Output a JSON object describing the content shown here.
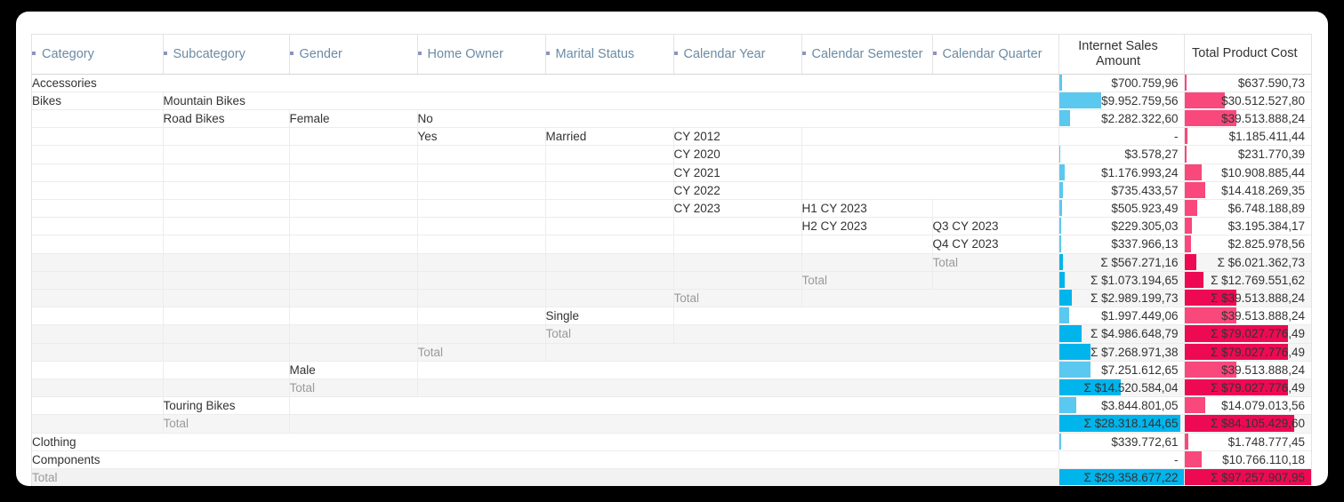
{
  "header": {
    "dimension_columns": [
      {
        "label": "Category",
        "marker": "square-bullet-icon"
      },
      {
        "label": "Subcategory",
        "marker": "square-bullet-icon"
      },
      {
        "label": "Gender",
        "marker": "square-bullet-icon"
      },
      {
        "label": "Home Owner",
        "marker": "square-bullet-icon"
      },
      {
        "label": "Marital Status",
        "marker": "square-bullet-icon"
      },
      {
        "label": "Calendar Year",
        "marker": "square-bullet-icon"
      },
      {
        "label": "Calendar Semester",
        "marker": "square-bullet-icon"
      },
      {
        "label": "Calendar Quarter",
        "marker": "square-bullet-icon"
      }
    ],
    "measure_columns": [
      {
        "label": "Internet Sales Amount",
        "bar_color": "#5BC8EF",
        "total_bar_color": "#00B4EC"
      },
      {
        "label": "Total Product Cost",
        "bar_color": "#F9487B",
        "total_bar_color": "#ED0A53"
      }
    ]
  },
  "colors": {
    "accent_blue": "#00B4EC",
    "light_blue": "#5BC8EF",
    "accent_pink": "#ED0A53",
    "light_pink": "#F9487B",
    "header_text": "#6B8BA4",
    "total_text": "#9A9A9A",
    "total_bg": "#F5F5F5"
  },
  "labels": {
    "total": "Total",
    "sigma": "Σ",
    "dash": "-"
  },
  "rows": [
    {
      "cells": [
        "Accessories",
        "",
        "",
        "",
        "",
        "",
        "",
        ""
      ],
      "sales": "$700.759,96",
      "cost": "$637.590,73",
      "sales_bar": 2.8,
      "cost_bar": 1.4,
      "is_total": false,
      "span": [
        8,
        0,
        0,
        0,
        0,
        0,
        0,
        0
      ]
    },
    {
      "cells": [
        "Bikes",
        "Mountain Bikes",
        "",
        "",
        "",
        "",
        "",
        ""
      ],
      "sales": "$9.952.759,56",
      "cost": "$30.512.527,80",
      "sales_bar": 34.0,
      "cost_bar": 31.6,
      "is_total": false,
      "span": [
        1,
        7,
        0,
        0,
        0,
        0,
        0,
        0
      ]
    },
    {
      "cells": [
        "",
        "Road Bikes",
        "Female",
        "No",
        "",
        "",
        "",
        ""
      ],
      "sales": "$2.282.322,60",
      "cost": "$39.513.888,24",
      "sales_bar": 9.0,
      "cost_bar": 40.9,
      "is_total": false,
      "span": [
        0,
        1,
        1,
        5,
        0,
        0,
        0,
        0
      ]
    },
    {
      "cells": [
        "",
        "",
        "",
        "Yes",
        "Married",
        "CY 2012",
        "",
        ""
      ],
      "sales": "-",
      "cost": "$1.185.411,44",
      "sales_bar": 0,
      "cost_bar": 1.6,
      "is_total": false,
      "span": [
        0,
        0,
        0,
        1,
        1,
        1,
        2,
        0
      ]
    },
    {
      "cells": [
        "",
        "",
        "",
        "",
        "",
        "CY 2020",
        "",
        ""
      ],
      "sales": "$3.578,27",
      "cost": "$231.770,39",
      "sales_bar": 0.6,
      "cost_bar": 0.6,
      "is_total": false,
      "span": [
        0,
        0,
        0,
        0,
        0,
        1,
        2,
        0
      ]
    },
    {
      "cells": [
        "",
        "",
        "",
        "",
        "",
        "CY 2021",
        "",
        ""
      ],
      "sales": "$1.176.993,24",
      "cost": "$10.908.885,44",
      "sales_bar": 4.5,
      "cost_bar": 13.0,
      "is_total": false,
      "span": [
        0,
        0,
        0,
        0,
        0,
        1,
        2,
        0
      ]
    },
    {
      "cells": [
        "",
        "",
        "",
        "",
        "",
        "CY 2022",
        "",
        ""
      ],
      "sales": "$735.433,57",
      "cost": "$14.418.269,35",
      "sales_bar": 3.2,
      "cost_bar": 16.2,
      "is_total": false,
      "span": [
        0,
        0,
        0,
        0,
        0,
        1,
        2,
        0
      ]
    },
    {
      "cells": [
        "",
        "",
        "",
        "",
        "",
        "CY 2023",
        "H1 CY 2023",
        ""
      ],
      "sales": "$505.923,49",
      "cost": "$6.748.188,89",
      "sales_bar": 2.8,
      "cost_bar": 9.6,
      "is_total": false,
      "span": [
        0,
        0,
        0,
        0,
        0,
        1,
        1,
        1
      ]
    },
    {
      "cells": [
        "",
        "",
        "",
        "",
        "",
        "",
        "H2 CY 2023",
        "Q3 CY 2023"
      ],
      "sales": "$229.305,03",
      "cost": "$3.195.384,17",
      "sales_bar": 2.1,
      "cost_bar": 5.0,
      "is_total": false,
      "span": [
        0,
        0,
        0,
        0,
        0,
        0,
        1,
        1
      ]
    },
    {
      "cells": [
        "",
        "",
        "",
        "",
        "",
        "",
        "",
        "Q4 CY 2023"
      ],
      "sales": "$337.966,13",
      "cost": "$2.825.978,56",
      "sales_bar": 2.1,
      "cost_bar": 4.3,
      "is_total": false,
      "span": [
        0,
        0,
        0,
        0,
        0,
        0,
        0,
        1
      ]
    },
    {
      "cells": [
        "",
        "",
        "",
        "",
        "",
        "",
        "",
        "Total"
      ],
      "sales": "Σ $567.271,16",
      "cost": "Σ $6.021.362,73",
      "sales_bar": 3.2,
      "cost_bar": 8.6,
      "is_total": true,
      "total_col": 7,
      "span": [
        0,
        0,
        0,
        0,
        0,
        0,
        0,
        1
      ]
    },
    {
      "cells": [
        "",
        "",
        "",
        "",
        "",
        "",
        "Total",
        ""
      ],
      "sales": "Σ $1.073.194,65",
      "cost": "Σ $12.769.551,62",
      "sales_bar": 4.5,
      "cost_bar": 14.6,
      "is_total": true,
      "total_col": 6,
      "span": [
        0,
        0,
        0,
        0,
        0,
        0,
        1,
        1
      ]
    },
    {
      "cells": [
        "",
        "",
        "",
        "",
        "",
        "Total",
        "",
        ""
      ],
      "sales": "Σ $2.989.199,73",
      "cost": "Σ $39.513.888,24",
      "sales_bar": 10.6,
      "cost_bar": 40.9,
      "is_total": true,
      "total_col": 5,
      "span": [
        0,
        0,
        0,
        0,
        0,
        1,
        2,
        0
      ]
    },
    {
      "cells": [
        "",
        "",
        "",
        "",
        "Single",
        "",
        "",
        ""
      ],
      "sales": "$1.997.449,06",
      "cost": "$39.513.888,24",
      "sales_bar": 8.0,
      "cost_bar": 40.9,
      "is_total": false,
      "span": [
        0,
        0,
        0,
        0,
        1,
        3,
        0,
        0
      ]
    },
    {
      "cells": [
        "",
        "",
        "",
        "",
        "Total",
        "",
        "",
        ""
      ],
      "sales": "Σ $4.986.648,79",
      "cost": "Σ $79.027.776,49",
      "sales_bar": 18.0,
      "cost_bar": 81.4,
      "is_total": true,
      "total_col": 4,
      "span": [
        0,
        0,
        0,
        0,
        1,
        3,
        0,
        0
      ]
    },
    {
      "cells": [
        "",
        "",
        "",
        "Total",
        "",
        "",
        "",
        ""
      ],
      "sales": "Σ $7.268.971,38",
      "cost": "Σ $79.027.776,49",
      "sales_bar": 25.0,
      "cost_bar": 81.4,
      "is_total": true,
      "total_col": 3,
      "span": [
        0,
        0,
        0,
        1,
        4,
        0,
        0,
        0
      ]
    },
    {
      "cells": [
        "",
        "",
        "Male",
        "",
        "",
        "",
        "",
        ""
      ],
      "sales": "$7.251.612,65",
      "cost": "$39.513.888,24",
      "sales_bar": 25.0,
      "cost_bar": 40.9,
      "is_total": false,
      "span": [
        0,
        0,
        1,
        5,
        0,
        0,
        0,
        0
      ]
    },
    {
      "cells": [
        "",
        "",
        "Total",
        "",
        "",
        "",
        "",
        ""
      ],
      "sales": "Σ $14.520.584,04",
      "cost": "Σ $79.027.776,49",
      "sales_bar": 49.5,
      "cost_bar": 81.4,
      "is_total": true,
      "total_col": 2,
      "span": [
        0,
        0,
        1,
        5,
        0,
        0,
        0,
        0
      ]
    },
    {
      "cells": [
        "",
        "Touring Bikes",
        "",
        "",
        "",
        "",
        "",
        ""
      ],
      "sales": "$3.844.801,05",
      "cost": "$14.079.013,56",
      "sales_bar": 13.5,
      "cost_bar": 15.9,
      "is_total": false,
      "span": [
        0,
        1,
        6,
        0,
        0,
        0,
        0,
        0
      ]
    },
    {
      "cells": [
        "",
        "Total",
        "",
        "",
        "",
        "",
        "",
        ""
      ],
      "sales": "Σ $28.318.144,65",
      "cost": "Σ $84.105.429,60",
      "sales_bar": 96.5,
      "cost_bar": 86.5,
      "is_total": true,
      "total_col": 1,
      "span": [
        0,
        1,
        6,
        0,
        0,
        0,
        0,
        0
      ]
    },
    {
      "cells": [
        "Clothing",
        "",
        "",
        "",
        "",
        "",
        "",
        ""
      ],
      "sales": "$339.772,61",
      "cost": "$1.748.777,45",
      "sales_bar": 1.5,
      "cost_bar": 2.2,
      "is_total": false,
      "span": [
        8,
        0,
        0,
        0,
        0,
        0,
        0,
        0
      ]
    },
    {
      "cells": [
        "Components",
        "",
        "",
        "",
        "",
        "",
        "",
        ""
      ],
      "sales": "-",
      "cost": "$10.766.110,18",
      "sales_bar": 0,
      "cost_bar": 13.0,
      "is_total": false,
      "span": [
        8,
        0,
        0,
        0,
        0,
        0,
        0,
        0
      ]
    },
    {
      "cells": [
        "Total",
        "",
        "",
        "",
        "",
        "",
        "",
        ""
      ],
      "sales": "Σ $29.358.677,22",
      "cost": "Σ $97.257.907,95",
      "sales_bar": 100,
      "cost_bar": 100,
      "is_total": true,
      "total_col": 0,
      "grand": true,
      "span": [
        8,
        0,
        0,
        0,
        0,
        0,
        0,
        0
      ]
    }
  ]
}
